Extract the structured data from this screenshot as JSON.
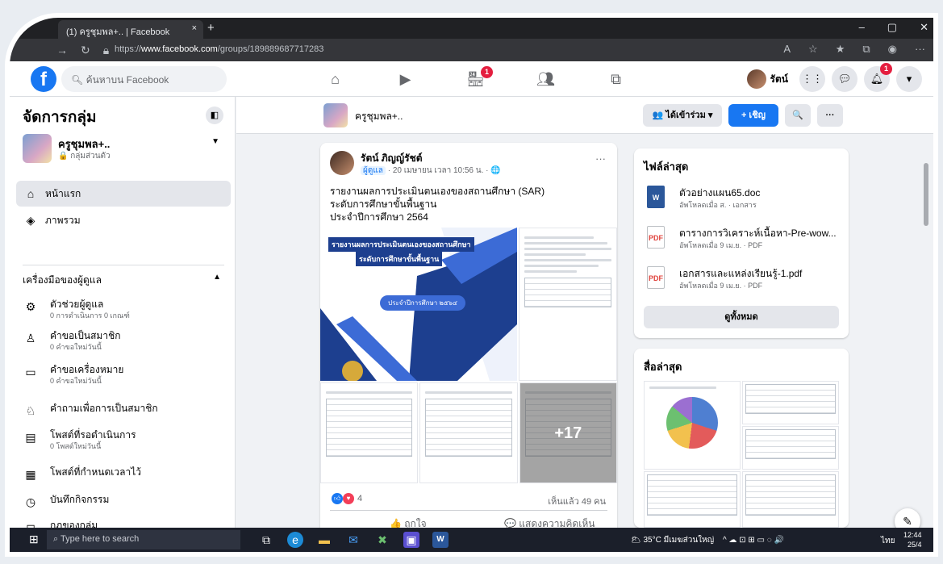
{
  "browser": {
    "tab_title": "(1) ครูชุมพล+.. | Facebook",
    "tab_close": "×",
    "new_tab": "+",
    "url_prefix": "https://",
    "url_domain": "www.facebook.com",
    "url_path": "/groups/189889687717283"
  },
  "fb": {
    "search_placeholder": "ค้นหาบน Facebook",
    "notif_badge_marketplace": "1",
    "notif_badge_bell": "1",
    "profile_name": "รัตน์"
  },
  "sidebar": {
    "title": "จัดการกลุ่ม",
    "group_name": "ครูชุมพล+..",
    "group_privacy": "🔒 กลุ่มส่วนตัว",
    "nav": [
      {
        "label": "หน้าแรก"
      },
      {
        "label": "ภาพรวม"
      }
    ],
    "section_title": "เครื่องมือของผู้ดูแล",
    "tools": [
      {
        "label": "ตัวช่วยผู้ดูแล",
        "sub": "0 การดำเนินการ 0 เกณฑ์"
      },
      {
        "label": "คำขอเป็นสมาชิก",
        "sub": "0 คำขอใหม่วันนี้"
      },
      {
        "label": "คำขอเครื่องหมาย",
        "sub": "0 คำขอใหม่วันนี้"
      },
      {
        "label": "คำถามเพื่อการเป็นสมาชิก",
        "sub": ""
      },
      {
        "label": "โพสต์ที่รอดำเนินการ",
        "sub": "0 โพสต์ใหม่วันนี้"
      },
      {
        "label": "โพสต์ที่กำหนดเวลาไว้",
        "sub": ""
      },
      {
        "label": "บันทึกกิจกรรม",
        "sub": ""
      },
      {
        "label": "กฎของกลุ่ม",
        "sub": ""
      }
    ]
  },
  "group_header": {
    "name": "ครูชุมพล+..",
    "joined_label": "👥 ได้เข้าร่วม ▾",
    "invite_label": "+ เชิญ",
    "search_label": "🔍",
    "more_label": "···"
  },
  "post": {
    "author": "รัตน์ ภิญญ์รัชต์",
    "role": "ผู้ดูแล",
    "meta": " · 20 เมษายน เวลา 10:56 น. · 🌐",
    "more": "···",
    "text_line1": "รายงานผลการประเมินตนเองของสถานศึกษา (SAR)",
    "text_line2": "ระดับการศึกษาขั้นพื้นฐาน",
    "text_line3": "ประจำปีการศึกษา 2564",
    "cover_title1": "รายงานผลการประเมินตนเองของสถานศึกษา",
    "cover_title2": "ระดับการศึกษาขั้นพื้นฐาน",
    "cover_year": "ประจำปีการศึกษา ๒๕๖๔",
    "more_photos": "+17",
    "reaction_count": "4",
    "seen_by": "เห็นแล้ว 49 คน",
    "like_label": "👍 ถูกใจ",
    "comment_label": "💬 แสดงความคิดเห็น"
  },
  "files": {
    "title": "ไฟล์ล่าสุด",
    "items": [
      {
        "name": "ตัวอย่างแผน65.doc",
        "meta": "อัพโหลดเมื่อ ส. · เอกสาร",
        "type": "W"
      },
      {
        "name": "ตารางการวิเคราะห์เนื้อหา-Pre-wow...",
        "meta": "อัพโหลดเมื่อ 9 เม.ย. · PDF",
        "type": "PDF"
      },
      {
        "name": "เอกสารและแหล่งเรียนรู้-1.pdf",
        "meta": "อัพโหลดเมื่อ 9 เม.ย. · PDF",
        "type": "PDF"
      }
    ],
    "see_all": "ดูทั้งหมด"
  },
  "media": {
    "title": "สื่อล่าสุด"
  },
  "taskbar": {
    "search_placeholder": "Type here to search",
    "weather": "🌥 35°C มีเมฆส่วนใหญ่",
    "tray_icons": "^ ☁ ⊡ ⊞ ▭ ◌ 🔊",
    "lang": "ไทย",
    "time": "12:44",
    "date": "25/4"
  }
}
